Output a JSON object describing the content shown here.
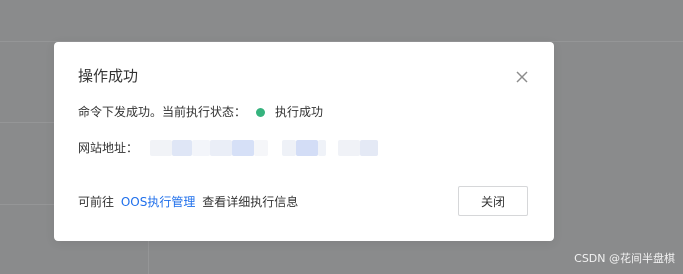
{
  "dialog": {
    "title": "操作成功",
    "status_prefix": "命令下发成功。当前执行状态：",
    "status_text": "执行成功",
    "status_color": "#36b37e",
    "site_label": "网站地址：",
    "footer_prefix": "可前往",
    "footer_link": "OOS执行管理",
    "footer_suffix": "查看详细执行信息",
    "close_button_label": "关闭",
    "close_icon": "close-icon",
    "link_color": "#1f6feb"
  },
  "watermark": "CSDN @花间半盘棋"
}
